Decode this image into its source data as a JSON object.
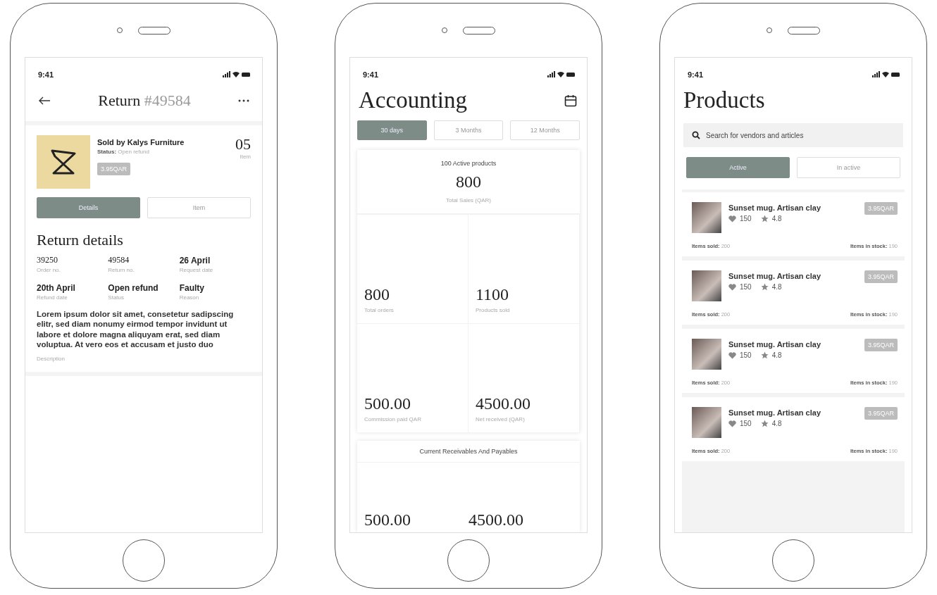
{
  "phones": [
    {
      "kind": "return",
      "status_bar": {
        "time": "9:41"
      },
      "title": "Return",
      "title_number": "#49584",
      "vendor": {
        "name": "Sold by Kalys Furniture",
        "status_label": "Status:",
        "status_value": "Open refund",
        "price": "3.95QAR",
        "count": "05",
        "count_label": "Item"
      },
      "tabs": [
        {
          "label": "Details",
          "selected": true
        },
        {
          "label": "Item",
          "selected": false
        }
      ],
      "section_title": "Return details",
      "details": [
        {
          "kind": "number",
          "value": "39250",
          "label": "Order no."
        },
        {
          "kind": "number",
          "value": "49584",
          "label": "Return no."
        },
        {
          "kind": "text",
          "value": "26 April",
          "label": "Request date"
        },
        {
          "kind": "text",
          "value": "20th April",
          "label": "Refund date"
        },
        {
          "kind": "text",
          "value": "Open refund",
          "label": "Status"
        },
        {
          "kind": "text",
          "value": "Faulty",
          "label": "Reason"
        }
      ],
      "description": {
        "text": "Lorem ipsum dolor sit amet, consetetur sadipscing elitr, sed diam nonumy eirmod tempor invidunt ut labore et dolore magna aliquyam erat, sed diam voluptua. At vero eos et accusam et justo duo",
        "label": "Description"
      }
    },
    {
      "kind": "accounting",
      "status_bar": {
        "time": "9:41"
      },
      "title": "Accounting",
      "tabs": [
        {
          "label": "30 days",
          "selected": true
        },
        {
          "label": "3 Months",
          "selected": false
        },
        {
          "label": "12 Months",
          "selected": false
        }
      ],
      "summary": {
        "heading": "100 Active products",
        "value": "800",
        "label": "Total Sales (QAR)"
      },
      "stats": [
        {
          "value": "800",
          "label": "Total orders"
        },
        {
          "value": "1100",
          "label": "Products sold"
        },
        {
          "value": "500.00",
          "label": "Commission paid QAR"
        },
        {
          "value": "4500.00",
          "label": "Net received (QAR)"
        }
      ],
      "receivables": {
        "heading": "Current Receivables And Payables",
        "values": [
          "500.00",
          "4500.00"
        ]
      }
    },
    {
      "kind": "products",
      "status_bar": {
        "time": "9:41"
      },
      "title": "Products",
      "search": {
        "placeholder": "Search for vendors and articles"
      },
      "tabs": [
        {
          "label": "Active",
          "selected": true
        },
        {
          "label": "In active",
          "selected": false
        }
      ],
      "products": [
        {
          "name": "Sunset mug. Artisan clay",
          "likes": "150",
          "rating": "4.8",
          "price": "3.95QAR",
          "sold_label": "Items sold:",
          "sold": "200",
          "stock_label": "Items in stock:",
          "stock": "190"
        },
        {
          "name": "Sunset mug. Artisan clay",
          "likes": "150",
          "rating": "4.8",
          "price": "3.95QAR",
          "sold_label": "Items sold:",
          "sold": "200",
          "stock_label": "Items in stock:",
          "stock": "190"
        },
        {
          "name": "Sunset mug. Artisan clay",
          "likes": "150",
          "rating": "4.8",
          "price": "3.95QAR",
          "sold_label": "Items sold:",
          "sold": "200",
          "stock_label": "Items in stock:",
          "stock": "190"
        },
        {
          "name": "Sunset mug. Artisan clay",
          "likes": "150",
          "rating": "4.8",
          "price": "3.95QAR",
          "sold_label": "Items sold:",
          "sold": "200",
          "stock_label": "Items in stock:",
          "stock": "190"
        }
      ]
    }
  ]
}
